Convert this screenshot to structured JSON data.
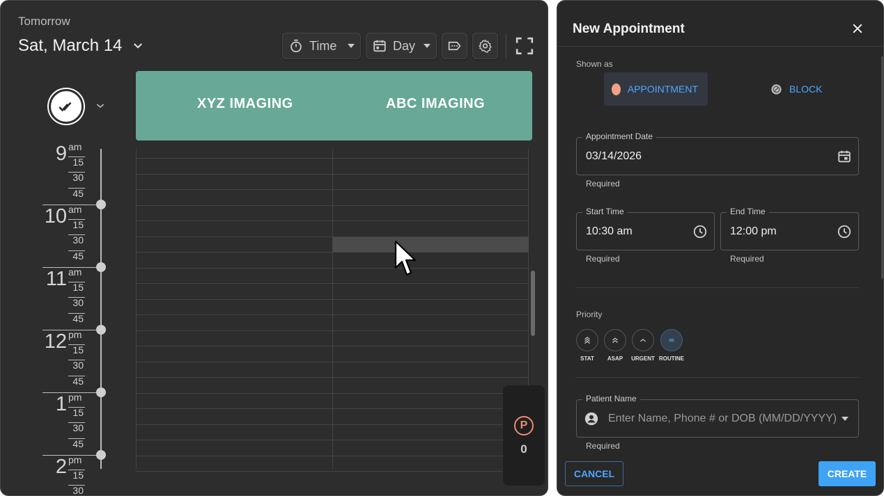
{
  "calendar": {
    "subtitle": "Tomorrow",
    "date_label": "Sat, March 14",
    "toolbar": {
      "time_label": "Time",
      "view_label": "Day"
    },
    "resources": [
      "XYZ IMAGING",
      "ABC IMAGING"
    ],
    "hours": [
      {
        "num": "9",
        "ampm": "am"
      },
      {
        "num": "10",
        "ampm": "am"
      },
      {
        "num": "11",
        "ampm": "am"
      },
      {
        "num": "12",
        "ampm": "pm"
      },
      {
        "num": "1",
        "ampm": "pm"
      },
      {
        "num": "2",
        "ampm": "pm"
      }
    ],
    "minute_labels": [
      "15",
      "30",
      "45"
    ],
    "pending_count": "0",
    "pending_badge": "P",
    "colors": {
      "background": "#2d2d2d",
      "resource_header": "#67a896",
      "pending_badge": "#e98d72"
    }
  },
  "form": {
    "title": "New Appointment",
    "shown_as": {
      "label": "Shown as",
      "options": [
        "APPOINTMENT",
        "BLOCK"
      ],
      "selected": "APPOINTMENT"
    },
    "appointment_date": {
      "label": "Appointment Date",
      "value": "03/14/2026",
      "helper": "Required"
    },
    "start_time": {
      "label": "Start Time",
      "value": "10:30 am",
      "helper": "Required"
    },
    "end_time": {
      "label": "End Time",
      "value": "12:00 pm",
      "helper": "Required"
    },
    "priority": {
      "label": "Priority",
      "options": [
        "STAT",
        "ASAP",
        "URGENT",
        "ROUTINE"
      ],
      "selected": "ROUTINE"
    },
    "patient_name": {
      "label": "Patient Name",
      "placeholder": "Enter Name, Phone # or DOB (MM/DD/YYYY)",
      "helper": "Required"
    },
    "buttons": {
      "cancel": "CANCEL",
      "create": "CREATE"
    },
    "colors": {
      "accent": "#4fa6ff",
      "primary_button": "#3fa3f5",
      "appointment_dot": "#f4a283"
    }
  }
}
